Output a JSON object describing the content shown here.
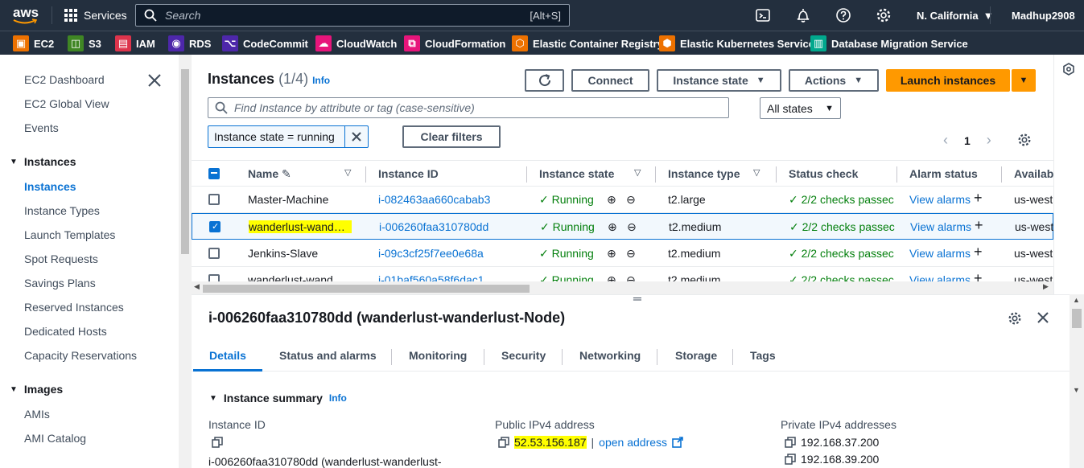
{
  "topnav": {
    "logo_text": "aws",
    "services_label": "Services",
    "search_placeholder": "Search",
    "search_shortcut": "[Alt+S]",
    "region": "N. California",
    "user": "Madhup2908"
  },
  "favorites": [
    {
      "label": "EC2",
      "color": "#ed7100"
    },
    {
      "label": "S3",
      "color": "#3f8624"
    },
    {
      "label": "IAM",
      "color": "#dd344c"
    },
    {
      "label": "RDS",
      "color": "#4d27aa"
    },
    {
      "label": "CodeCommit",
      "color": "#4d27aa"
    },
    {
      "label": "CloudWatch",
      "color": "#e7157b"
    },
    {
      "label": "CloudFormation",
      "color": "#e7157b"
    },
    {
      "label": "Elastic Container Registry",
      "color": "#ed7100"
    },
    {
      "label": "Elastic Kubernetes Service",
      "color": "#ed7100"
    },
    {
      "label": "Database Migration Service",
      "color": "#01a88d"
    }
  ],
  "sidebar": {
    "top_items": [
      "EC2 Dashboard",
      "EC2 Global View",
      "Events"
    ],
    "sections": [
      {
        "title": "Instances",
        "items": [
          "Instances",
          "Instance Types",
          "Launch Templates",
          "Spot Requests",
          "Savings Plans",
          "Reserved Instances",
          "Dedicated Hosts",
          "Capacity Reservations"
        ]
      },
      {
        "title": "Images",
        "items": [
          "AMIs",
          "AMI Catalog"
        ]
      }
    ],
    "active_item": "Instances"
  },
  "instances_panel": {
    "title": "Instances",
    "count": "(1/4)",
    "info": "Info",
    "connect_label": "Connect",
    "instance_state_label": "Instance state",
    "actions_label": "Actions",
    "launch_label": "Launch instances",
    "filter_placeholder": "Find Instance by attribute or tag (case-sensitive)",
    "state_select": "All states",
    "filter_token": "Instance state = running",
    "clear_filters_label": "Clear filters",
    "page": "1",
    "columns": [
      "Name",
      "Instance ID",
      "Instance state",
      "Instance type",
      "Status check",
      "Alarm status",
      "Availab"
    ],
    "rows": [
      {
        "name": "Master-Machine",
        "id": "i-082463aa660cabab3",
        "state": "Running",
        "type": "t2.large",
        "status": "2/2 checks passec",
        "alarm": "View alarms",
        "az": "us-west",
        "selected": false
      },
      {
        "name": "wanderlust-wand…",
        "id": "i-006260faa310780dd",
        "state": "Running",
        "type": "t2.medium",
        "status": "2/2 checks passec",
        "alarm": "View alarms",
        "az": "us-west",
        "selected": true
      },
      {
        "name": "Jenkins-Slave",
        "id": "i-09c3cf25f7ee0e68a",
        "state": "Running",
        "type": "t2.medium",
        "status": "2/2 checks passec",
        "alarm": "View alarms",
        "az": "us-west",
        "selected": false
      },
      {
        "name": "wanderlust-wand",
        "id": "i-01baf560a58f6dac1",
        "state": "Running",
        "type": "t2.medium",
        "status": "2/2 checks passec",
        "alarm": "View alarms",
        "az": "us-west",
        "selected": false
      }
    ]
  },
  "detail": {
    "title": "i-006260faa310780dd (wanderlust-wanderlust-Node)",
    "tabs": [
      "Details",
      "Status and alarms",
      "Monitoring",
      "Security",
      "Networking",
      "Storage",
      "Tags"
    ],
    "active_tab": "Details",
    "summary_title": "Instance summary",
    "summary_info": "Info",
    "fields": {
      "instance_id_label": "Instance ID",
      "instance_id_value": "i-006260faa310780dd (wanderlust-wanderlust-",
      "public_ip_label": "Public IPv4 address",
      "public_ip_value": "52.53.156.187",
      "open_address": "open address",
      "private_ip_label": "Private IPv4 addresses",
      "private_ips": [
        "192.168.37.200",
        "192.168.39.200"
      ]
    }
  }
}
